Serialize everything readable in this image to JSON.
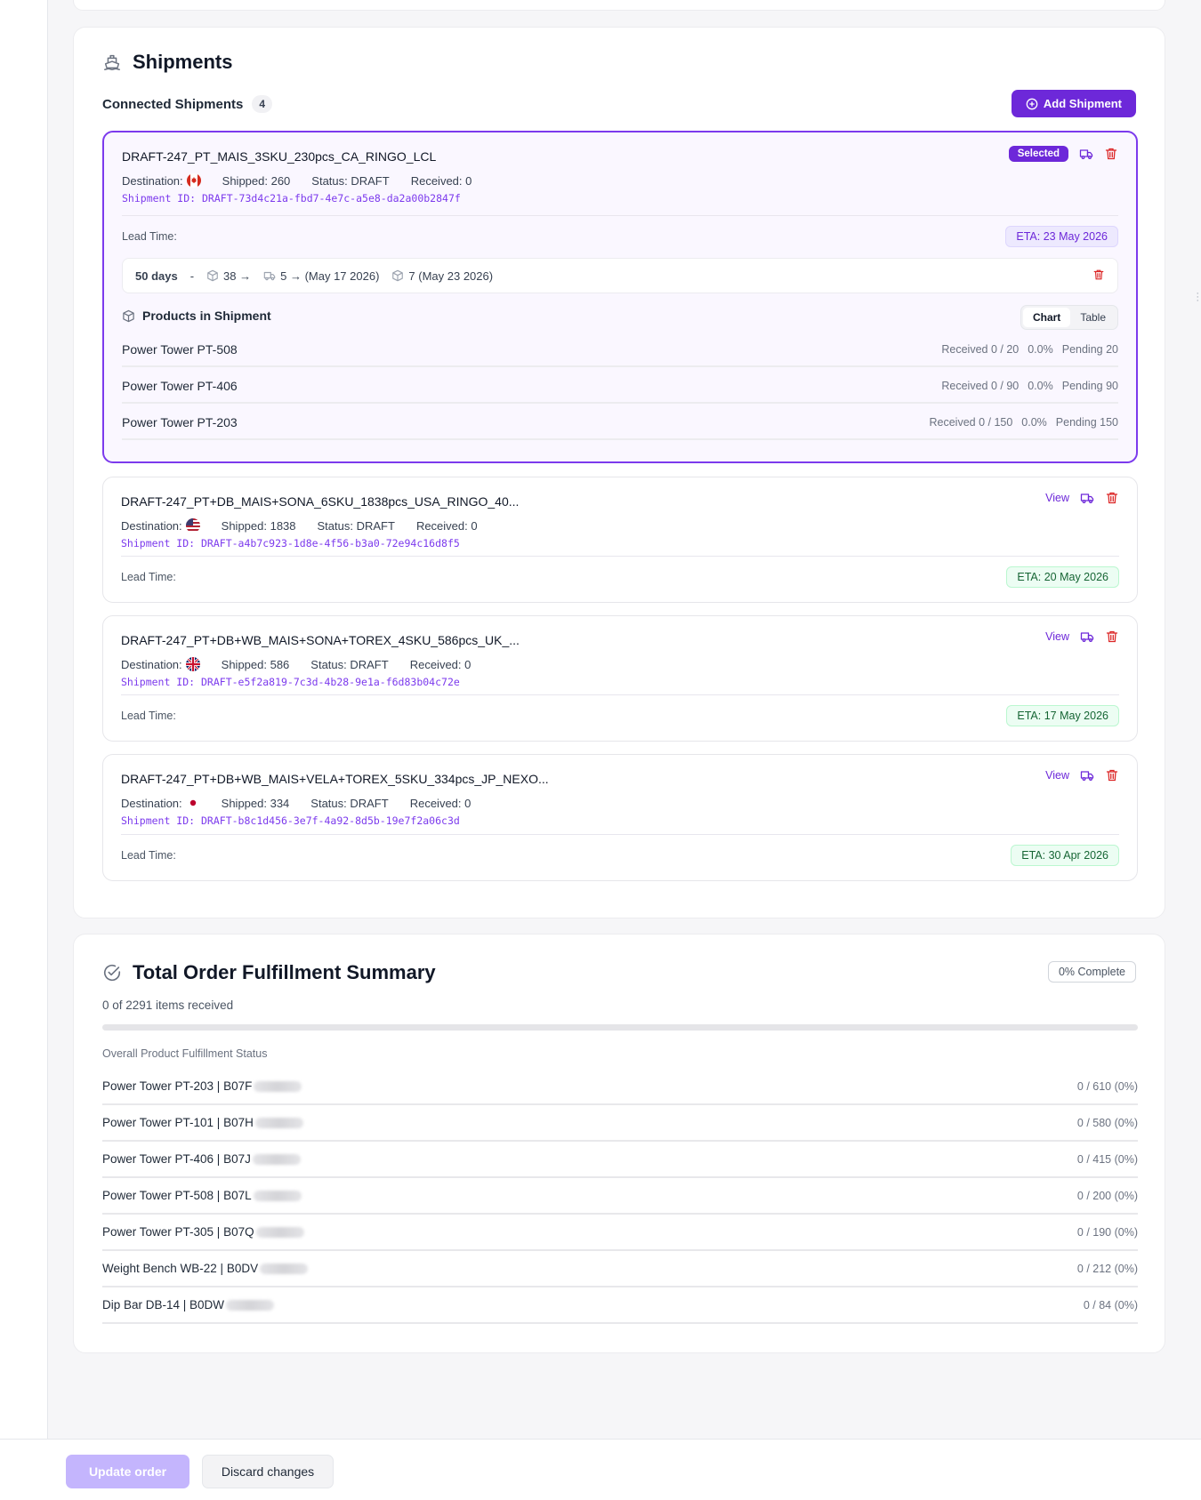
{
  "shipments_section": {
    "title": "Shipments",
    "connected_label": "Connected Shipments",
    "connected_count": "4",
    "add_button": "Add Shipment",
    "items": [
      {
        "name": "DRAFT-247_PT_MAIS_3SKU_230pcs_CA_RINGO_LCL",
        "destination_label": "Destination:",
        "destination_flag": "canada-flag",
        "shipped": "Shipped: 260",
        "status": "Status: DRAFT",
        "received": "Received: 0",
        "shipment_id": "Shipment ID: DRAFT-73d4c21a-fbd7-4e7c-a5e8-da2a00b2847f",
        "lead_label": "Lead Time:",
        "eta": "ETA: 23 May 2026",
        "selected_badge": "Selected",
        "lead_box": {
          "days": "50 days",
          "dash": "-",
          "seg1": "38 →",
          "seg2": "5 → (May 17 2026)",
          "seg3": "7 (May 23 2026)"
        },
        "products_title": "Products in Shipment",
        "toggle": [
          "Chart",
          "Table"
        ],
        "products": [
          {
            "name": "Power Tower PT-508",
            "received": "Received 0 / 20",
            "pct": "0.0%",
            "pending": "Pending 20"
          },
          {
            "name": "Power Tower PT-406",
            "received": "Received 0 / 90",
            "pct": "0.0%",
            "pending": "Pending 90"
          },
          {
            "name": "Power Tower PT-203",
            "received": "Received 0 / 150",
            "pct": "0.0%",
            "pending": "Pending 150"
          }
        ]
      },
      {
        "name": "DRAFT-247_PT+DB_MAIS+SONA_6SKU_1838pcs_USA_RINGO_40...",
        "destination_label": "Destination:",
        "destination_flag": "usa-flag",
        "shipped": "Shipped: 1838",
        "status": "Status: DRAFT",
        "received": "Received: 0",
        "shipment_id": "Shipment ID: DRAFT-a4b7c923-1d8e-4f56-b3a0-72e94c16d8f5",
        "lead_label": "Lead Time:",
        "eta": "ETA: 20 May 2026",
        "view": "View"
      },
      {
        "name": "DRAFT-247_PT+DB+WB_MAIS+SONA+TOREX_4SKU_586pcs_UK_...",
        "destination_label": "Destination:",
        "destination_flag": "uk-flag",
        "shipped": "Shipped: 586",
        "status": "Status: DRAFT",
        "received": "Received: 0",
        "shipment_id": "Shipment ID: DRAFT-e5f2a819-7c3d-4b28-9e1a-f6d83b04c72e",
        "lead_label": "Lead Time:",
        "eta": "ETA: 17 May 2026",
        "view": "View"
      },
      {
        "name": "DRAFT-247_PT+DB+WB_MAIS+VELA+TOREX_5SKU_334pcs_JP_NEXO...",
        "destination_label": "Destination:",
        "destination_flag": "japan-flag",
        "shipped": "Shipped: 334",
        "status": "Status: DRAFT",
        "received": "Received: 0",
        "shipment_id": "Shipment ID: DRAFT-b8c1d456-3e7f-4a92-8d5b-19e7f2a06c3d",
        "lead_label": "Lead Time:",
        "eta": "ETA: 30 Apr 2026",
        "view": "View"
      }
    ]
  },
  "summary": {
    "title": "Total Order Fulfillment Summary",
    "complete_badge": "0% Complete",
    "items_received": "0 of 2291 items received",
    "progress_fraction": 0,
    "overall_label": "Overall Product Fulfillment Status",
    "rows": [
      {
        "name": "Power Tower PT-203 | B07F",
        "value": "0 / 610 (0%)"
      },
      {
        "name": "Power Tower PT-101 | B07H",
        "value": "0 / 580 (0%)"
      },
      {
        "name": "Power Tower PT-406 | B07J",
        "value": "0 / 415 (0%)"
      },
      {
        "name": "Power Tower PT-508 | B07L",
        "value": "0 / 200 (0%)"
      },
      {
        "name": "Power Tower PT-305 | B07Q",
        "value": "0 / 190 (0%)"
      },
      {
        "name": "Weight Bench WB-22 | B0DV",
        "value": "0 / 212 (0%)"
      },
      {
        "name": "Dip Bar DB-14 | B0DW",
        "value": "0 / 84 (0%)"
      }
    ]
  },
  "footer": {
    "update_button": "Update order",
    "discard_button": "Discard changes"
  },
  "colors": {
    "accent": "#6d28d9",
    "accent_light": "#c4b5fd",
    "danger": "#dc2626",
    "eta_green": "#166534"
  }
}
